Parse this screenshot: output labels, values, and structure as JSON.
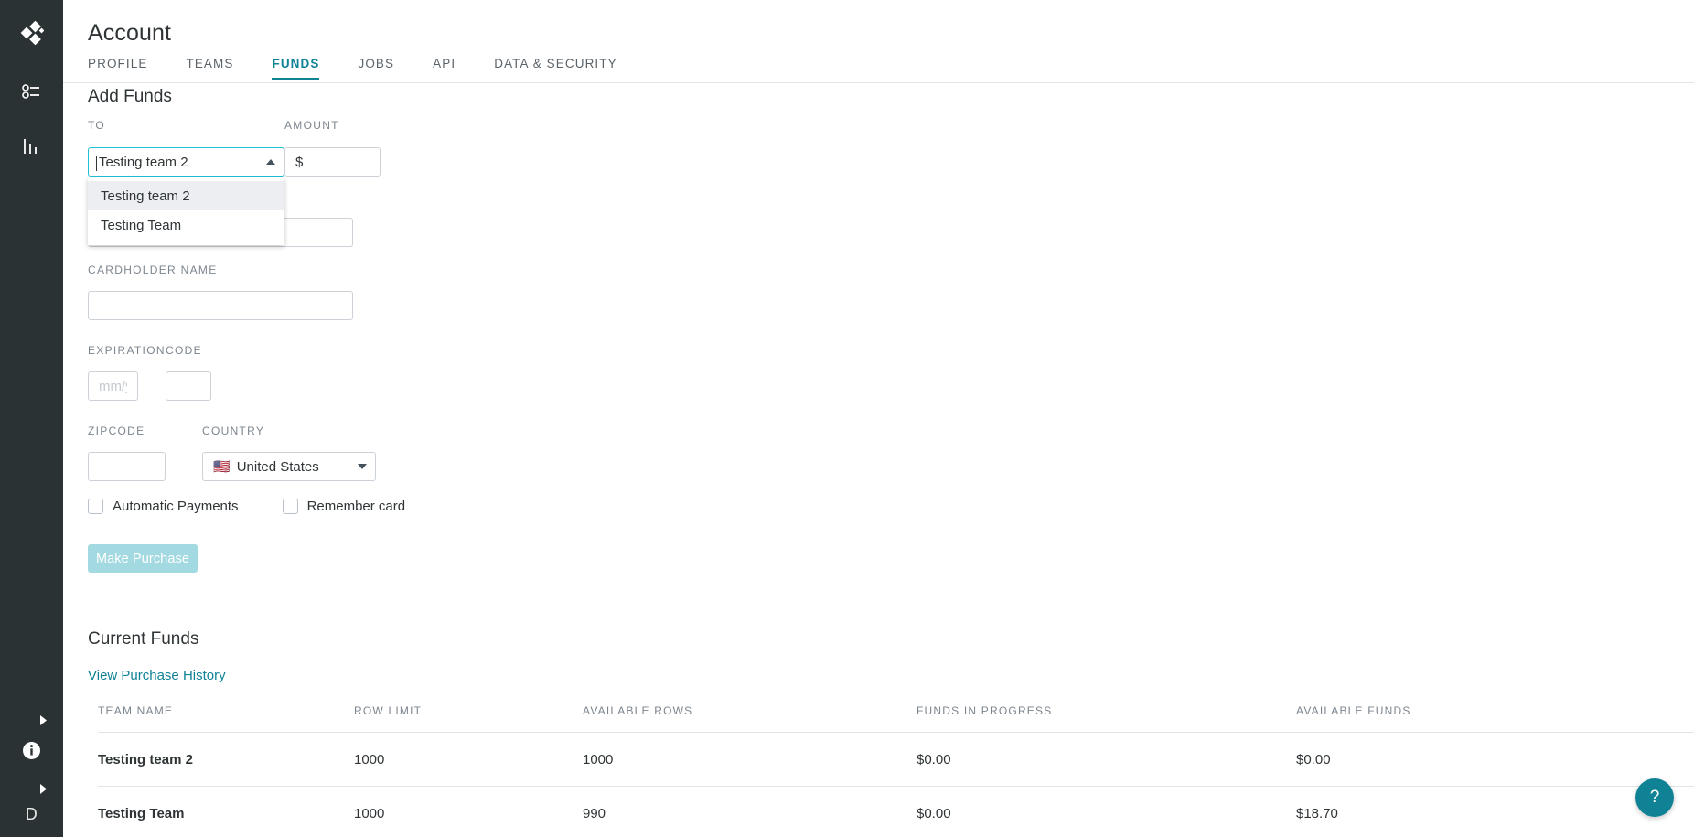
{
  "sidebar": {
    "logo_icon": "diamond-cluster-logo",
    "items": [
      {
        "icon": "list-settings-icon",
        "name": "list"
      },
      {
        "icon": "bar-chart-icon",
        "name": "chart"
      }
    ],
    "info_icon": "info-icon",
    "expand_icon": "chevron-right-icon",
    "avatar_initial": "D"
  },
  "header": {
    "title": "Account",
    "tabs": [
      {
        "label": "PROFILE",
        "active": false
      },
      {
        "label": "TEAMS",
        "active": false
      },
      {
        "label": "FUNDS",
        "active": true
      },
      {
        "label": "JOBS",
        "active": false
      },
      {
        "label": "API",
        "active": false
      },
      {
        "label": "DATA & SECURITY",
        "active": false
      }
    ]
  },
  "add_funds": {
    "section_title": "Add Funds",
    "to": {
      "label": "TO",
      "value": "Testing team 2",
      "expanded": true,
      "caret_icon": "triangle-up-icon",
      "options": [
        {
          "label": "Testing team 2",
          "highlighted": true
        },
        {
          "label": "Testing Team",
          "highlighted": false
        }
      ]
    },
    "amount": {
      "label": "AMOUNT",
      "value": "$",
      "placeholder": ""
    },
    "card_number": {
      "value": "",
      "placeholder": ""
    },
    "cardholder_name": {
      "label": "CARDHOLDER NAME",
      "value": "",
      "placeholder": ""
    },
    "expiration": {
      "label": "EXPIRATION",
      "value": "",
      "placeholder": "mm/yy"
    },
    "code": {
      "label": "CODE",
      "value": "",
      "placeholder": ""
    },
    "zipcode": {
      "label": "ZIPCODE",
      "value": "",
      "placeholder": ""
    },
    "country": {
      "label": "COUNTRY",
      "flag": "🇺🇸",
      "value": "United States",
      "caret_icon": "triangle-down-icon"
    },
    "automatic_payments": {
      "label": "Automatic Payments",
      "checked": false
    },
    "remember_card": {
      "label": "Remember card",
      "checked": false
    },
    "submit": {
      "label": "Make Purchase",
      "disabled": true
    }
  },
  "current_funds": {
    "section_title": "Current Funds",
    "history_link": "View Purchase History",
    "columns": [
      "TEAM NAME",
      "ROW LIMIT",
      "AVAILABLE ROWS",
      "FUNDS IN PROGRESS",
      "AVAILABLE FUNDS"
    ],
    "rows": [
      {
        "team_name": "Testing team 2",
        "row_limit": "1000",
        "available_rows": "1000",
        "funds_in_progress": "$0.00",
        "available_funds": "$0.00"
      },
      {
        "team_name": "Testing Team",
        "row_limit": "1000",
        "available_rows": "990",
        "funds_in_progress": "$0.00",
        "available_funds": "$18.70"
      }
    ]
  },
  "help": {
    "label": "?",
    "icon": "question-mark-icon"
  },
  "colors": {
    "accent": "#0f8296",
    "focus_border": "#1fc0d4",
    "disabled_button": "#a3d9e0",
    "rail_bg": "#2b3233",
    "label_text": "#7c858e"
  }
}
